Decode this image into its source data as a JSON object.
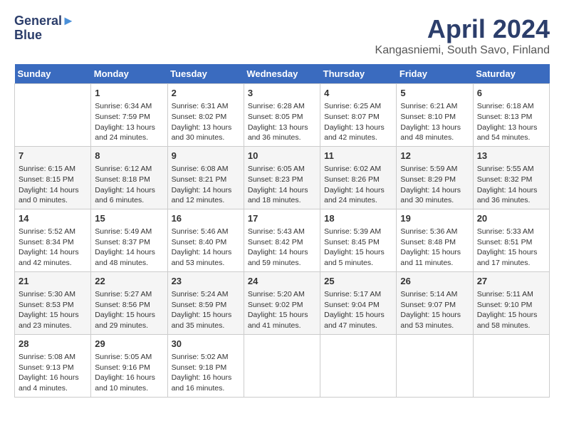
{
  "header": {
    "logo_line1": "General",
    "logo_line2": "Blue",
    "title": "April 2024",
    "subtitle": "Kangasniemi, South Savo, Finland"
  },
  "days_of_week": [
    "Sunday",
    "Monday",
    "Tuesday",
    "Wednesday",
    "Thursday",
    "Friday",
    "Saturday"
  ],
  "weeks": [
    [
      {
        "num": "",
        "info": ""
      },
      {
        "num": "1",
        "info": "Sunrise: 6:34 AM\nSunset: 7:59 PM\nDaylight: 13 hours\nand 24 minutes."
      },
      {
        "num": "2",
        "info": "Sunrise: 6:31 AM\nSunset: 8:02 PM\nDaylight: 13 hours\nand 30 minutes."
      },
      {
        "num": "3",
        "info": "Sunrise: 6:28 AM\nSunset: 8:05 PM\nDaylight: 13 hours\nand 36 minutes."
      },
      {
        "num": "4",
        "info": "Sunrise: 6:25 AM\nSunset: 8:07 PM\nDaylight: 13 hours\nand 42 minutes."
      },
      {
        "num": "5",
        "info": "Sunrise: 6:21 AM\nSunset: 8:10 PM\nDaylight: 13 hours\nand 48 minutes."
      },
      {
        "num": "6",
        "info": "Sunrise: 6:18 AM\nSunset: 8:13 PM\nDaylight: 13 hours\nand 54 minutes."
      }
    ],
    [
      {
        "num": "7",
        "info": "Sunrise: 6:15 AM\nSunset: 8:15 PM\nDaylight: 14 hours\nand 0 minutes."
      },
      {
        "num": "8",
        "info": "Sunrise: 6:12 AM\nSunset: 8:18 PM\nDaylight: 14 hours\nand 6 minutes."
      },
      {
        "num": "9",
        "info": "Sunrise: 6:08 AM\nSunset: 8:21 PM\nDaylight: 14 hours\nand 12 minutes."
      },
      {
        "num": "10",
        "info": "Sunrise: 6:05 AM\nSunset: 8:23 PM\nDaylight: 14 hours\nand 18 minutes."
      },
      {
        "num": "11",
        "info": "Sunrise: 6:02 AM\nSunset: 8:26 PM\nDaylight: 14 hours\nand 24 minutes."
      },
      {
        "num": "12",
        "info": "Sunrise: 5:59 AM\nSunset: 8:29 PM\nDaylight: 14 hours\nand 30 minutes."
      },
      {
        "num": "13",
        "info": "Sunrise: 5:55 AM\nSunset: 8:32 PM\nDaylight: 14 hours\nand 36 minutes."
      }
    ],
    [
      {
        "num": "14",
        "info": "Sunrise: 5:52 AM\nSunset: 8:34 PM\nDaylight: 14 hours\nand 42 minutes."
      },
      {
        "num": "15",
        "info": "Sunrise: 5:49 AM\nSunset: 8:37 PM\nDaylight: 14 hours\nand 48 minutes."
      },
      {
        "num": "16",
        "info": "Sunrise: 5:46 AM\nSunset: 8:40 PM\nDaylight: 14 hours\nand 53 minutes."
      },
      {
        "num": "17",
        "info": "Sunrise: 5:43 AM\nSunset: 8:42 PM\nDaylight: 14 hours\nand 59 minutes."
      },
      {
        "num": "18",
        "info": "Sunrise: 5:39 AM\nSunset: 8:45 PM\nDaylight: 15 hours\nand 5 minutes."
      },
      {
        "num": "19",
        "info": "Sunrise: 5:36 AM\nSunset: 8:48 PM\nDaylight: 15 hours\nand 11 minutes."
      },
      {
        "num": "20",
        "info": "Sunrise: 5:33 AM\nSunset: 8:51 PM\nDaylight: 15 hours\nand 17 minutes."
      }
    ],
    [
      {
        "num": "21",
        "info": "Sunrise: 5:30 AM\nSunset: 8:53 PM\nDaylight: 15 hours\nand 23 minutes."
      },
      {
        "num": "22",
        "info": "Sunrise: 5:27 AM\nSunset: 8:56 PM\nDaylight: 15 hours\nand 29 minutes."
      },
      {
        "num": "23",
        "info": "Sunrise: 5:24 AM\nSunset: 8:59 PM\nDaylight: 15 hours\nand 35 minutes."
      },
      {
        "num": "24",
        "info": "Sunrise: 5:20 AM\nSunset: 9:02 PM\nDaylight: 15 hours\nand 41 minutes."
      },
      {
        "num": "25",
        "info": "Sunrise: 5:17 AM\nSunset: 9:04 PM\nDaylight: 15 hours\nand 47 minutes."
      },
      {
        "num": "26",
        "info": "Sunrise: 5:14 AM\nSunset: 9:07 PM\nDaylight: 15 hours\nand 53 minutes."
      },
      {
        "num": "27",
        "info": "Sunrise: 5:11 AM\nSunset: 9:10 PM\nDaylight: 15 hours\nand 58 minutes."
      }
    ],
    [
      {
        "num": "28",
        "info": "Sunrise: 5:08 AM\nSunset: 9:13 PM\nDaylight: 16 hours\nand 4 minutes."
      },
      {
        "num": "29",
        "info": "Sunrise: 5:05 AM\nSunset: 9:16 PM\nDaylight: 16 hours\nand 10 minutes."
      },
      {
        "num": "30",
        "info": "Sunrise: 5:02 AM\nSunset: 9:18 PM\nDaylight: 16 hours\nand 16 minutes."
      },
      {
        "num": "",
        "info": ""
      },
      {
        "num": "",
        "info": ""
      },
      {
        "num": "",
        "info": ""
      },
      {
        "num": "",
        "info": ""
      }
    ]
  ]
}
